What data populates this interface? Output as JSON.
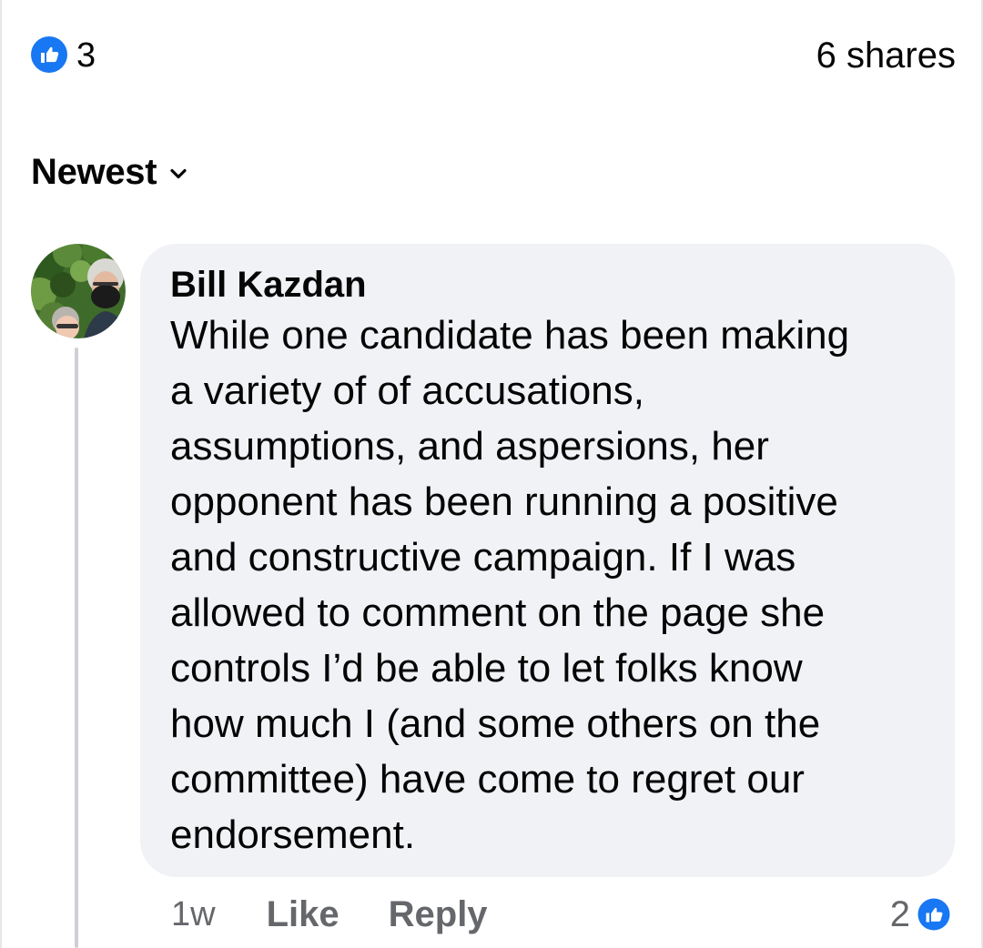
{
  "post_footer": {
    "reaction_icon": "like-thumbs-up",
    "reaction_count": "3",
    "shares": "6 shares"
  },
  "sort": {
    "label": "Newest",
    "icon": "chevron-down-icon"
  },
  "comment": {
    "author": "Bill Kazdan",
    "text": "While one candidate has been making\na variety of of accusations,\nassumptions, and aspersions, her\nopponent has been running a positive\nand constructive campaign. If I was\nallowed to comment on the page she\ncontrols I’d be able to let folks know\nhow much I (and some others on the\ncommittee) have come to regret our\nendorsement.",
    "time": "1w",
    "like_label": "Like",
    "reply_label": "Reply",
    "reaction_count": "2"
  },
  "colors": {
    "facebook_blue": "#1877f2",
    "bubble_bg": "#f0f2f5",
    "secondary_text": "#65676b"
  }
}
